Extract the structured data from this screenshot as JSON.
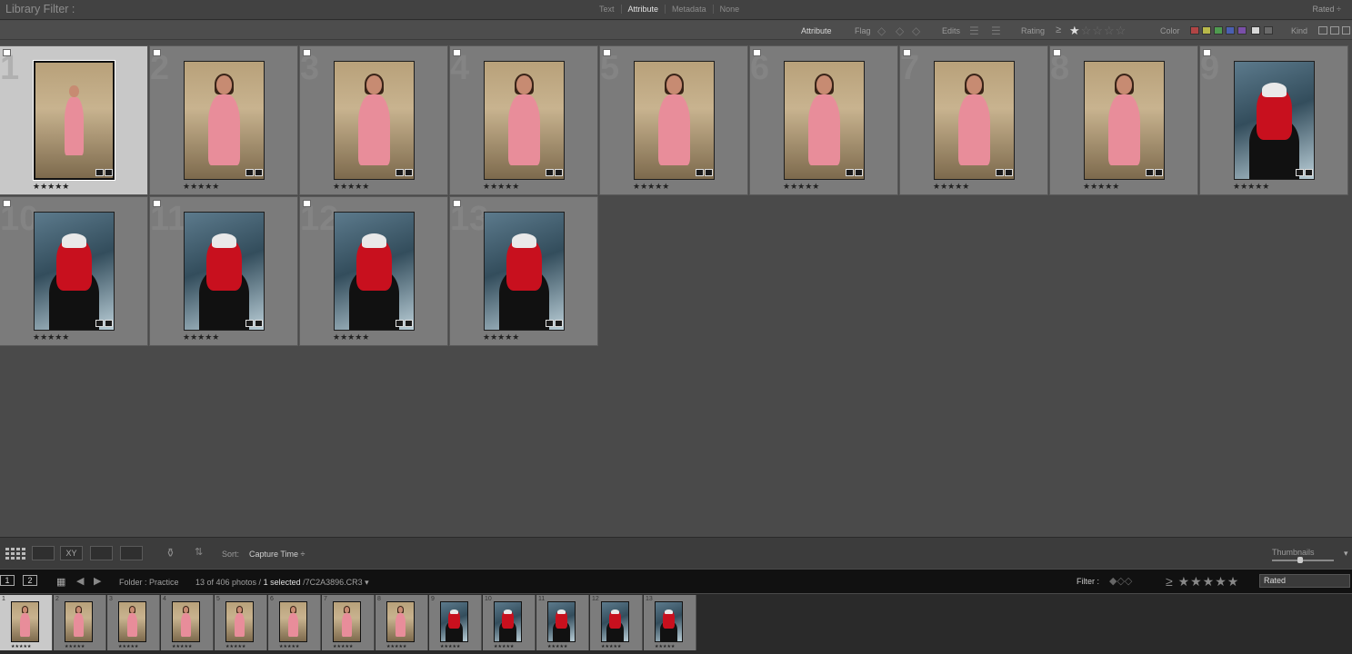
{
  "library_filter": {
    "title": "Library Filter :",
    "tabs": [
      "Text",
      "Attribute",
      "Metadata",
      "None"
    ],
    "active_tab": "Attribute",
    "preset": "Rated ÷"
  },
  "attribute_bar": {
    "label": "Attribute",
    "flag_label": "Flag",
    "edits_label": "Edits",
    "rating_label": "Rating",
    "rating_op": "≥",
    "rating_min": 1,
    "color_label": "Color",
    "color_swatches": [
      "#b04545",
      "#b8b84a",
      "#4f9a4f",
      "#4a5fb0",
      "#7a4fa8",
      "#d8d8d8",
      "#6a6a6a"
    ],
    "kind_label": "Kind"
  },
  "grid": {
    "photos": [
      {
        "index": "1",
        "stars": "★★★★★",
        "style": "warm-full",
        "selected": true
      },
      {
        "index": "2",
        "stars": "★★★★★",
        "style": "warm"
      },
      {
        "index": "3",
        "stars": "★★★★★",
        "style": "warm"
      },
      {
        "index": "4",
        "stars": "★★★★★",
        "style": "warm"
      },
      {
        "index": "5",
        "stars": "★★★★★",
        "style": "warm"
      },
      {
        "index": "6",
        "stars": "★★★★★",
        "style": "warm"
      },
      {
        "index": "7",
        "stars": "★★★★★",
        "style": "warm"
      },
      {
        "index": "8",
        "stars": "★★★★★",
        "style": "warm"
      },
      {
        "index": "9",
        "stars": "★★★★★",
        "style": "cool"
      },
      {
        "index": "10",
        "stars": "★★★★★",
        "style": "cool"
      },
      {
        "index": "11",
        "stars": "★★★★★",
        "style": "cool"
      },
      {
        "index": "12",
        "stars": "★★★★★",
        "style": "cool"
      },
      {
        "index": "13",
        "stars": "★★★★★",
        "style": "cool"
      }
    ]
  },
  "toolbar": {
    "sort_label": "Sort:",
    "sort_value": "Capture Time ÷",
    "thumbnails_label": "Thumbnails"
  },
  "filmstrip_header": {
    "monitor_1": "1",
    "monitor_2": "2",
    "folder": "Folder : Practice",
    "count": "13 of 406 photos /",
    "selected": "1 selected",
    "filename": "/7C2A3896.CR3 ▾",
    "filter_label": "Filter :",
    "filter_stars": "≥ ★★★★★",
    "filter_preset": "Rated"
  },
  "filmstrip": {
    "items": [
      "1",
      "2",
      "3",
      "4",
      "5",
      "6",
      "7",
      "8",
      "9",
      "10",
      "11",
      "12",
      "13"
    ]
  }
}
